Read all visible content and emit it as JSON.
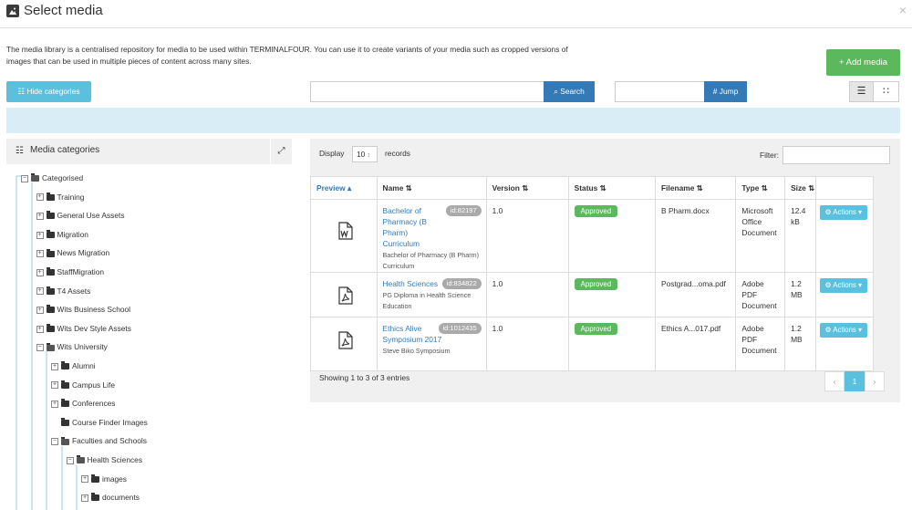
{
  "dialog": {
    "title": "Select media",
    "close_glyph": "×",
    "intro": "The media library is a centralised repository for media to be used within TERMINALFOUR. You can use it to create variants of your media such as cropped versions of images that can be used in multiple pieces of content across many sites."
  },
  "toolbar": {
    "add_media": "+ Add media",
    "hide_categories": "Hide categories",
    "search_value": "",
    "search_label": "Search",
    "jump_value": "",
    "jump_label": "# Jump"
  },
  "categories": {
    "title": "Media categories",
    "items": [
      {
        "label": "Categorised",
        "toggle": "−",
        "open": true,
        "level": 0
      },
      {
        "label": "Training",
        "toggle": "+",
        "open": false,
        "level": 1
      },
      {
        "label": "General Use Assets",
        "toggle": "+",
        "open": false,
        "level": 1
      },
      {
        "label": "Migration",
        "toggle": "+",
        "open": false,
        "level": 1
      },
      {
        "label": "News Migration",
        "toggle": "+",
        "open": false,
        "level": 1
      },
      {
        "label": "StaffMigration",
        "toggle": "+",
        "open": false,
        "level": 1
      },
      {
        "label": "T4 Assets",
        "toggle": "+",
        "open": false,
        "level": 1
      },
      {
        "label": "Wits Business School",
        "toggle": "+",
        "open": false,
        "level": 1
      },
      {
        "label": "Wits Dev Style Assets",
        "toggle": "+",
        "open": false,
        "level": 1
      },
      {
        "label": "Wits University",
        "toggle": "−",
        "open": true,
        "level": 1
      },
      {
        "label": "Alumni",
        "toggle": "+",
        "open": false,
        "level": 2
      },
      {
        "label": "Campus Life",
        "toggle": "+",
        "open": false,
        "level": 2
      },
      {
        "label": "Conferences",
        "toggle": "+",
        "open": false,
        "level": 2
      },
      {
        "label": "Course Finder Images",
        "toggle": "",
        "open": false,
        "level": 2
      },
      {
        "label": "Faculties and Schools",
        "toggle": "−",
        "open": true,
        "level": 2
      },
      {
        "label": "Health Sciences",
        "toggle": "−",
        "open": true,
        "level": 3
      },
      {
        "label": "images",
        "toggle": "+",
        "open": false,
        "level": 4
      },
      {
        "label": "documents",
        "toggle": "+",
        "open": false,
        "level": 4
      }
    ]
  },
  "table": {
    "display_label": "Display",
    "length_value": "10",
    "records_label": "records",
    "filter_label": "Filter:",
    "headers": [
      "Preview",
      "Name",
      "Version",
      "Status",
      "Filename",
      "Type",
      "Size"
    ],
    "rows": [
      {
        "icon": "word",
        "name": "Bachelor of Pharmacy (B Pharm) Curriculum",
        "id": "id:82197",
        "desc": "Bachelor of Pharmacy (B Pharm) Curriculum",
        "version": "1.0",
        "status": "Approved",
        "filename": "B Pharm.docx",
        "type": "Microsoft Office Document",
        "size": "12.4 kB",
        "actions": "Actions"
      },
      {
        "icon": "pdf",
        "name": "Health Sciences",
        "id": "id:834822",
        "desc": "PG Diploma in Health Science Education",
        "version": "1.0",
        "status": "Approved",
        "filename": "Postgrad...oma.pdf",
        "type": "Adobe PDF Document",
        "size": "1.2 MB",
        "actions": "Actions"
      },
      {
        "icon": "pdf",
        "name": "Ethics Alive Symposium 2017",
        "id": "id:1012435",
        "desc": "Steve Biko Symposium",
        "version": "1.0",
        "status": "Approved",
        "filename": "Ethics A...017.pdf",
        "type": "Adobe PDF Document",
        "size": "1.2 MB",
        "actions": "Actions"
      }
    ],
    "showing": "Showing 1 to 3 of 3 entries",
    "pager": {
      "prev": "‹",
      "current": "1",
      "next": "›"
    }
  }
}
